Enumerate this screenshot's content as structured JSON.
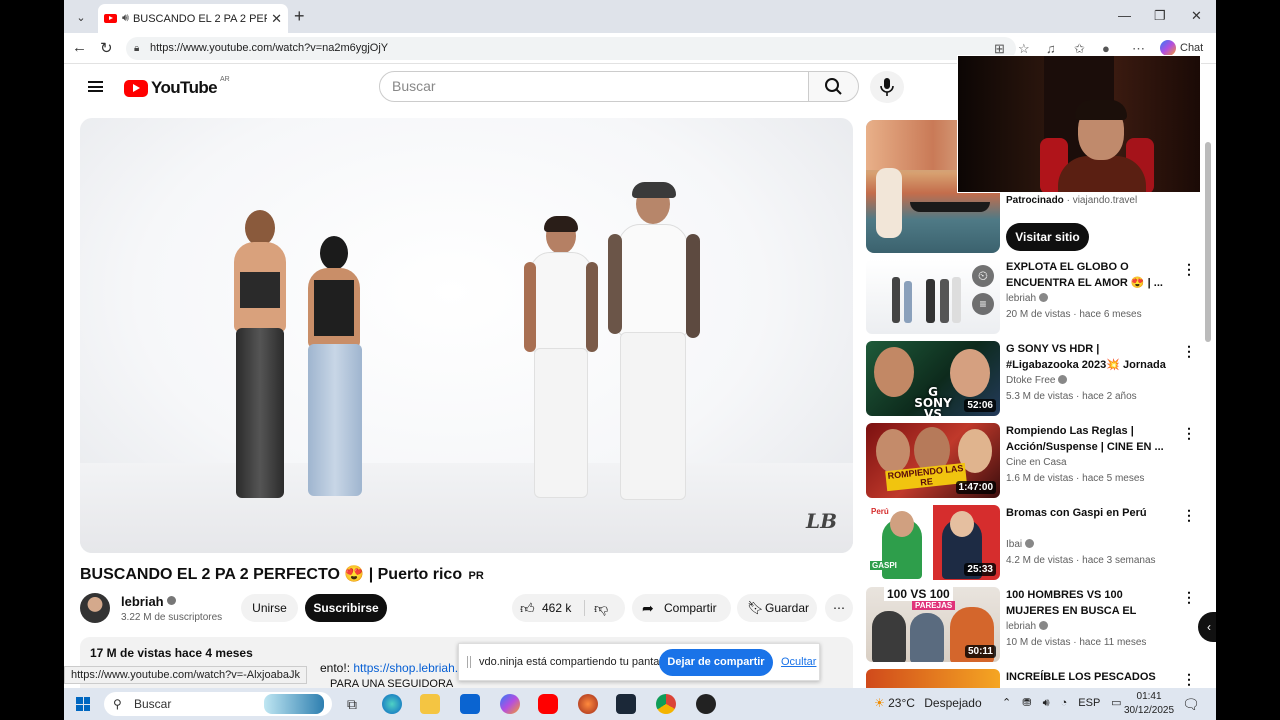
{
  "browser": {
    "tab_title": "BUSCANDO EL 2 PA 2 PERFEC",
    "url": "https://www.youtube.com/watch?v=na2m6ygjOjY",
    "chat_label": "Chat"
  },
  "youtube": {
    "logo_text": "YouTube",
    "country_code": "AR",
    "search_placeholder": "Buscar"
  },
  "video": {
    "title": "BUSCANDO EL 2 PA 2 PERFECTO 😍 | Puerto rico",
    "title_badge": "PR",
    "watermark": "LB",
    "channel_name": "lebriah",
    "subscribers": "3.22 M de suscriptores",
    "join_label": "Unirse",
    "subscribe_label": "Suscribirse",
    "likes": "462 k",
    "share_label": "Compartir",
    "save_label": "Guardar",
    "views_date": "17 M de vistas  hace 4 meses",
    "desc_partial": "ento!: ",
    "desc_link": "https://shop.lebriah.com",
    "desc_line2": "PARA UNA SEGUIDORA"
  },
  "ad": {
    "sponsored_label": "Patrocinado",
    "sponsor": "viajando.travel",
    "visit_label": "Visitar sitio"
  },
  "recommendations": [
    {
      "title": "EXPLOTA EL GLOBO O ENCUENTRA EL AMOR 😍 | ...",
      "channel": "lebriah",
      "verified": true,
      "meta": "20 M de vistas · hace 6 meses",
      "duration": ""
    },
    {
      "title": "G SONY VS HDR | #Ligabazooka 2023💥 Jornada 6",
      "channel": "Dtoke Free",
      "verified": true,
      "meta": "5.3 M de vistas · hace 2 años",
      "duration": "52:06"
    },
    {
      "title": "Rompiendo Las Reglas | Acción/Suspense | CINE EN ...",
      "channel": "Cine en Casa",
      "verified": false,
      "meta": "1.6 M de vistas · hace 5 meses",
      "duration": "1:47:00"
    },
    {
      "title": "Bromas con Gaspi en Perú",
      "channel": "Ibai",
      "verified": true,
      "meta": "4.2 M de vistas · hace 3 semanas",
      "duration": "25:33"
    },
    {
      "title": "100 HOMBRES VS 100 MUJERES EN BUSCA EL AMOR",
      "channel": "lebriah",
      "verified": true,
      "meta": "10 M de vistas · hace 11 meses",
      "duration": "50:11"
    },
    {
      "title": "INCREÍBLE LOS PESCADOS",
      "channel": "",
      "verified": false,
      "meta": "",
      "duration": ""
    }
  ],
  "thumb_texts": {
    "sony": "G SONY VS HDR",
    "rompiendo": "ROMPIENDO LAS RE",
    "gaspi_badge": "Perú",
    "gaspi_word": "GASPI",
    "hundred": "100 VS 100",
    "parejas": "PAREJAS"
  },
  "share_notice": {
    "text": "vdo.ninja está compartiendo tu pantalla.",
    "stop_label": "Dejar de compartir",
    "hide_label": "Ocultar"
  },
  "status_url": "https://www.youtube.com/watch?v=-AlxjoabaJk",
  "taskbar": {
    "search_label": "Buscar",
    "temperature": "23°C",
    "weather": "Despejado",
    "language": "ESP",
    "time": "01:41",
    "date": "30/12/2025"
  },
  "colors": {
    "youtube_red": "#ff0000",
    "subscribe_black": "#0f0f0f",
    "link_blue": "#065fd4",
    "share_blue": "#1a73e8"
  }
}
